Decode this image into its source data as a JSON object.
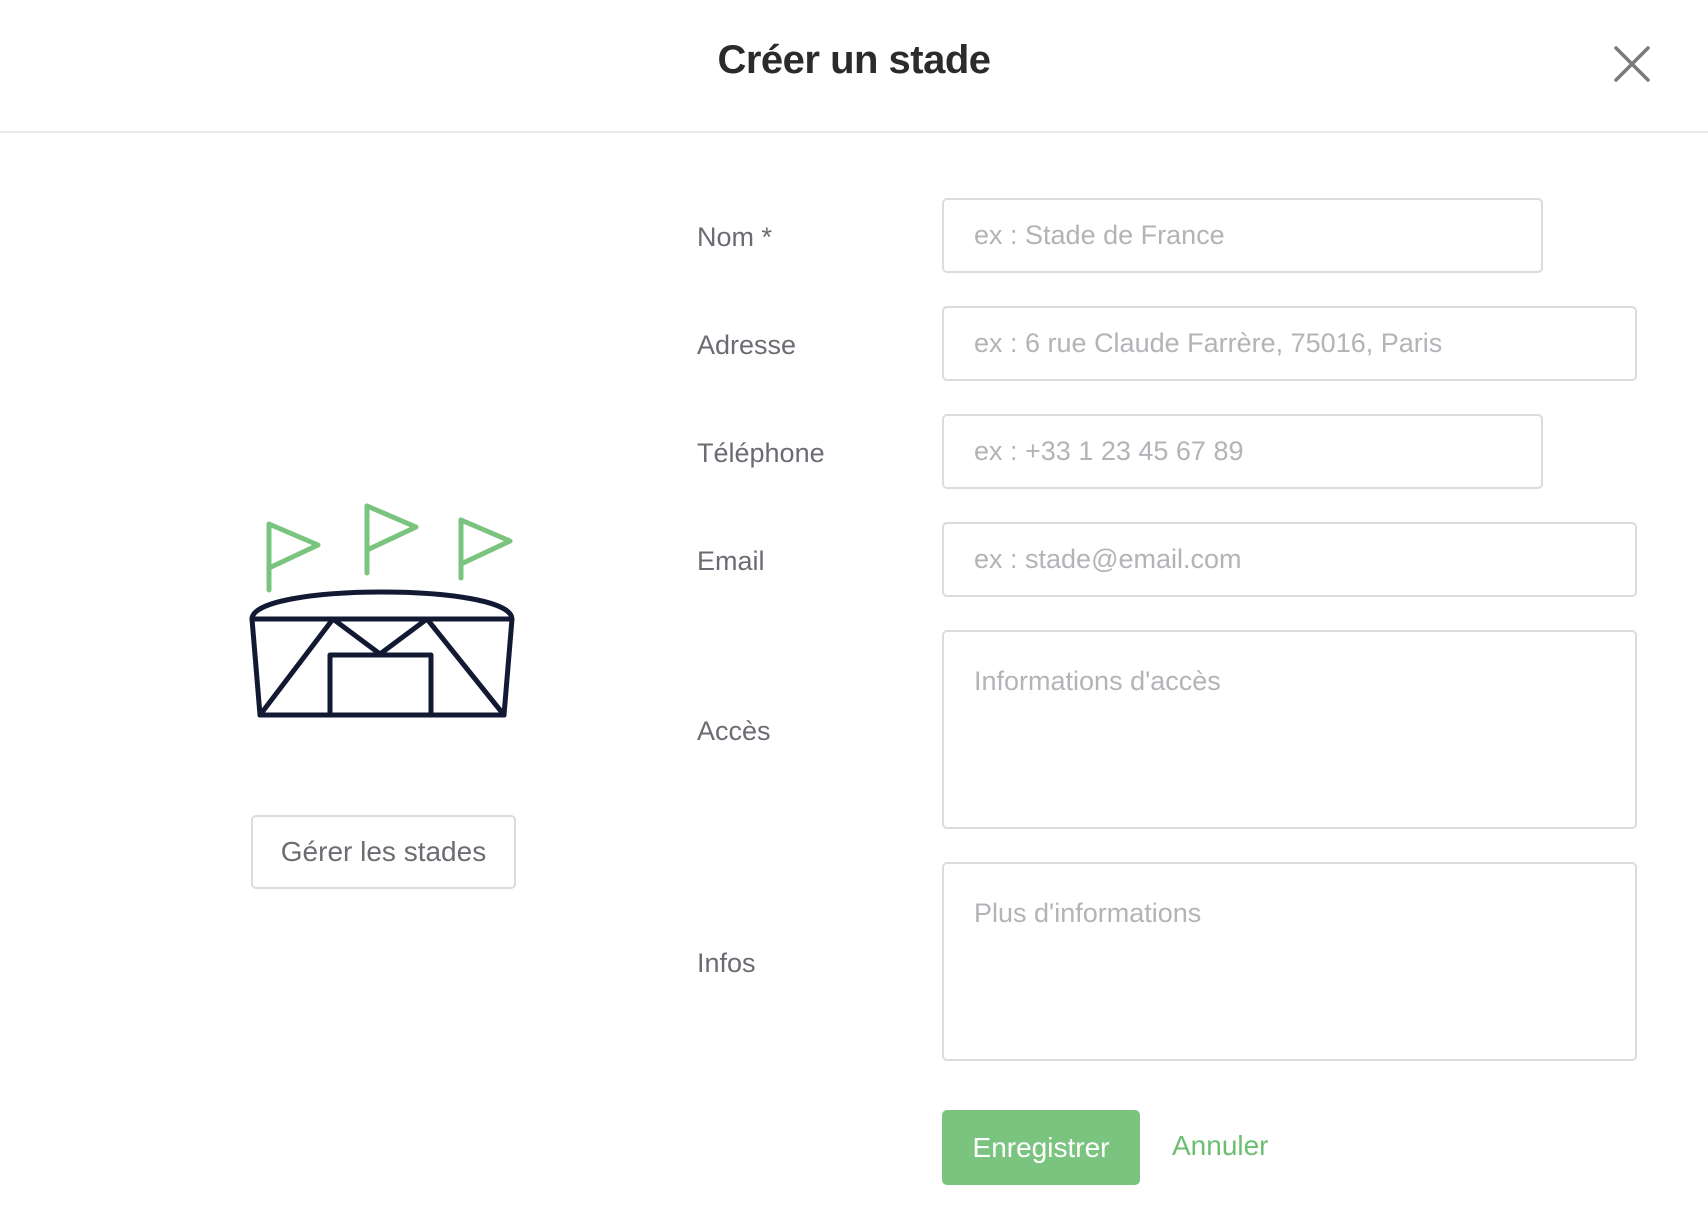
{
  "dialog": {
    "title": "Créer un stade"
  },
  "illustration": {
    "icon": "stadium-icon",
    "colors": {
      "flags": "#7bc47f",
      "stroke": "#121a33"
    }
  },
  "sidebar": {
    "manage_label": "Gérer les stades"
  },
  "form": {
    "name": {
      "label": "Nom *",
      "placeholder": "ex : Stade de France",
      "value": ""
    },
    "address": {
      "label": "Adresse",
      "placeholder": "ex : 6 rue Claude Farrère, 75016, Paris",
      "value": ""
    },
    "phone": {
      "label": "Téléphone",
      "placeholder": "ex : +33 1 23 45 67 89",
      "value": ""
    },
    "email": {
      "label": "Email",
      "placeholder": "ex : stade@email.com",
      "value": ""
    },
    "access": {
      "label": "Accès",
      "placeholder": "Informations d'accès",
      "value": ""
    },
    "infos": {
      "label": "Infos",
      "placeholder": "Plus d'informations",
      "value": ""
    }
  },
  "actions": {
    "save_label": "Enregistrer",
    "cancel_label": "Annuler"
  },
  "colors": {
    "accent": "#7bc47f",
    "text": "#2b2b2b",
    "label": "#6b6b73",
    "border": "#dcdcdc"
  }
}
